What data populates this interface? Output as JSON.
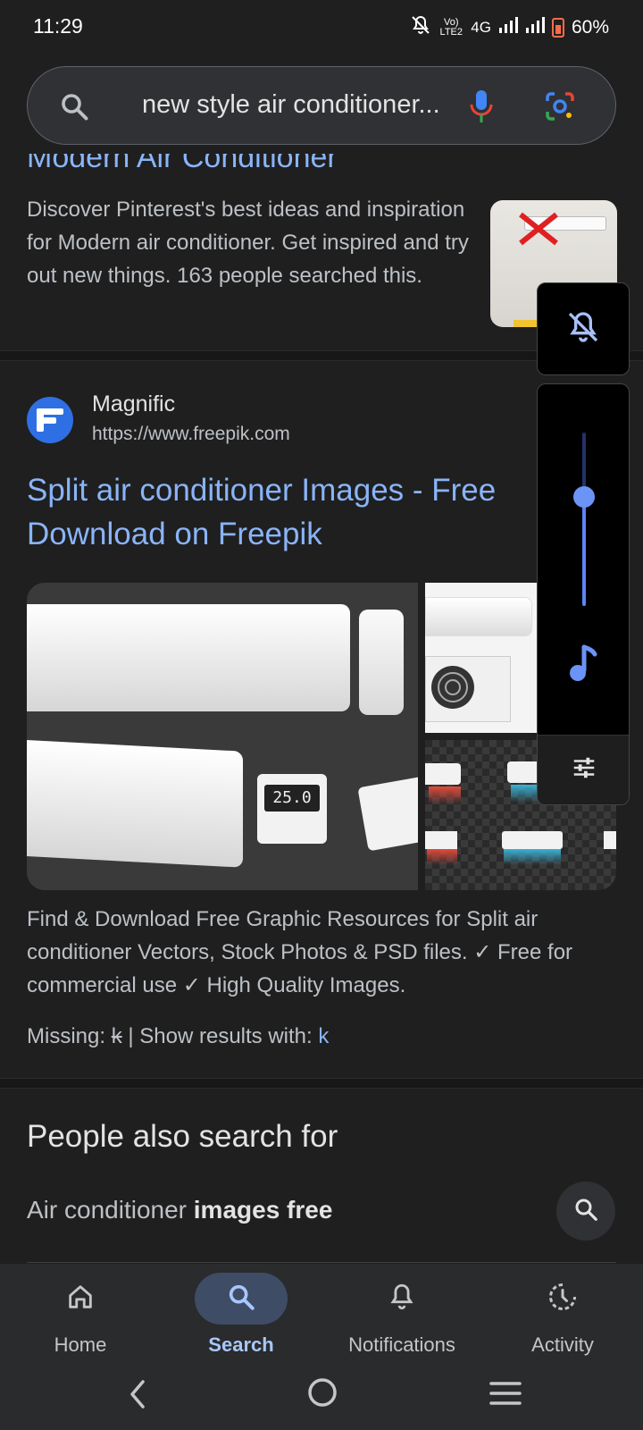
{
  "status": {
    "time": "11:29",
    "network_small": "Vo) LTE2",
    "network": "4G",
    "battery": "60%"
  },
  "search": {
    "query": "new style air conditioner..."
  },
  "result1": {
    "title_cut": "Modern Air Conditioner",
    "snippet": "Discover Pinterest's best ideas and inspiration for Modern air conditioner. Get inspired and try out new things. 163 people searched this."
  },
  "result2": {
    "site_name": "Magnific",
    "site_url": "https://www.freepik.com",
    "title": "Split air conditioner Images - Free Download on Freepik",
    "thermostat_reading": "25.0",
    "snippet": "Find & Download Free Graphic Resources for Split air conditioner Vectors, Stock Photos & PSD files. ✓ Free for commercial use ✓ High Quality Images.",
    "missing_label": "Missing:",
    "missing_term": "k",
    "show_results_label": "| Show results with:",
    "show_results_term": "k"
  },
  "people_also_search": {
    "title": "People also search for",
    "item_prefix": "Air conditioner",
    "item_bold": "images free"
  },
  "volume": {
    "level": 0.63
  },
  "bottom_nav": {
    "items": [
      {
        "label": "Home"
      },
      {
        "label": "Search"
      },
      {
        "label": "Notifications"
      },
      {
        "label": "Activity"
      }
    ]
  },
  "colors": {
    "background": "#1f1f1f",
    "link": "#8ab4f8",
    "active_nav": "#a8c7fa",
    "volume_accent": "#5b86f5"
  }
}
